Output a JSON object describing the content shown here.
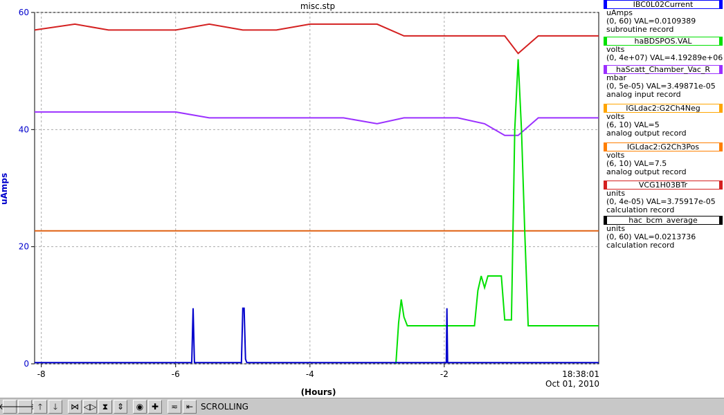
{
  "chart_data": {
    "type": "line",
    "title": "misc.stp",
    "xlabel": "(Hours)",
    "ylabel": "uAmps",
    "xlim": [
      -8.1,
      0.3
    ],
    "ylim": [
      0,
      60
    ],
    "x_ticks": [
      -8,
      -6,
      -4,
      -2
    ],
    "x_tick_labels": [
      "-8",
      "-6",
      "-4",
      "-2"
    ],
    "y_ticks": [
      0,
      20,
      40,
      60
    ],
    "y_tick_labels": [
      "0",
      "20",
      "40",
      "60"
    ],
    "x_end_label": "18:38:01",
    "x_date_label": "Oct 01, 2010",
    "grid": true,
    "series": [
      {
        "color": "#d42020",
        "x": [
          -8.1,
          -7.5,
          -7.0,
          -6.5,
          -6.0,
          -5.5,
          -5.0,
          -4.5,
          -4.0,
          -3.5,
          -3.0,
          -2.6,
          -2.2,
          -1.8,
          -1.4,
          -1.1,
          -0.9,
          -0.6,
          -0.3,
          0.0,
          0.3
        ],
        "values": [
          57,
          58,
          57,
          57,
          57,
          58,
          57,
          57,
          58,
          58,
          58,
          56,
          56,
          56,
          56,
          56,
          53,
          56,
          56,
          56,
          56
        ]
      },
      {
        "color": "#9b30ff",
        "x": [
          -8.1,
          -7.5,
          -7.0,
          -6.5,
          -6.0,
          -5.5,
          -5.0,
          -4.5,
          -4.0,
          -3.5,
          -3.0,
          -2.6,
          -2.2,
          -1.8,
          -1.4,
          -1.1,
          -0.9,
          -0.6,
          -0.3,
          0.0,
          0.3
        ],
        "values": [
          43,
          43,
          43,
          43,
          43,
          42,
          42,
          42,
          42,
          42,
          41,
          42,
          42,
          42,
          41,
          39,
          39,
          42,
          42,
          42,
          42
        ]
      },
      {
        "color": "#e06010",
        "x": [
          -8.1,
          0.3
        ],
        "values": [
          22.7,
          22.7
        ]
      },
      {
        "color": "#00e000",
        "x": [
          -2.72,
          -2.68,
          -2.64,
          -2.6,
          -2.55,
          -2.5,
          -2.0,
          -1.55,
          -1.5,
          -1.45,
          -1.4,
          -1.35,
          -1.3,
          -1.25,
          -1.15,
          -1.1,
          -1.0,
          -0.95,
          -0.9,
          -0.85,
          -0.8,
          -0.75,
          -0.7,
          -0.6,
          -0.5,
          0.0,
          0.3
        ],
        "values": [
          0,
          7,
          11,
          8,
          6.5,
          6.5,
          6.5,
          6.5,
          12.5,
          15,
          13,
          15,
          15,
          15,
          15,
          7.5,
          7.5,
          40,
          52,
          40,
          22,
          6.5,
          6.5,
          6.5,
          6.5,
          6.5,
          6.5
        ]
      },
      {
        "color": "#0000cc",
        "x": [
          -8.1,
          -5.76,
          -5.74,
          -5.72,
          -5.02,
          -5.0,
          -4.98,
          -4.96,
          -4.94,
          -1.97,
          -1.96,
          -1.95,
          0.3
        ],
        "values": [
          0.2,
          0.2,
          9.5,
          0.2,
          0.2,
          9.5,
          9.5,
          0.8,
          0.2,
          0.2,
          9.5,
          0.2,
          0.2
        ]
      }
    ]
  },
  "legend": [
    {
      "name": "IBC0L02Current",
      "color": "#0000ff",
      "units": "uAmps",
      "range_val": "(0, 60) VAL=0.0109389",
      "record": "subroutine record"
    },
    {
      "name": "haBDSPOS.VAL",
      "color": "#00e000",
      "units": "volts",
      "range_val": "(0, 4e+07) VAL=4.19289e+06",
      "record": ""
    },
    {
      "name": "haScatt_Chamber_Vac_R",
      "color": "#9b30ff",
      "units": "mbar",
      "range_val": "(0, 5e-05) VAL=3.49871e-05",
      "record": "analog input record"
    },
    {
      "name": "IGLdac2:G2Ch4Neg",
      "color": "#ffa500",
      "units": "volts",
      "range_val": "(6, 10) VAL=5",
      "record": "analog output record"
    },
    {
      "name": "IGLdac2:G2Ch3Pos",
      "color": "#ff7f00",
      "units": "volts",
      "range_val": "(6, 10) VAL=7.5",
      "record": "analog output record"
    },
    {
      "name": "VCG1H03BTr",
      "color": "#d42020",
      "units": "units",
      "range_val": "(0, 4e-05) VAL=3.75917e-05",
      "record": "calculation record"
    },
    {
      "name": "hac_bcm_average",
      "color": "#000000",
      "units": "units",
      "range_val": "(0, 60) VAL=0.0213736",
      "record": "calculation record"
    }
  ],
  "toolbar": {
    "buttons": [
      {
        "name": "scroll-left-button",
        "glyph": "🡐"
      },
      {
        "name": "scroll-right-button",
        "glyph": "🡒"
      },
      {
        "name": "scroll-up-button",
        "glyph": "🡑"
      },
      {
        "name": "scroll-down-button",
        "glyph": "🡓"
      },
      {
        "name": "zoom-in-x-button",
        "glyph": "⋈"
      },
      {
        "name": "zoom-out-x-button",
        "glyph": "◁▷"
      },
      {
        "name": "zoom-in-y-button",
        "glyph": "⧗"
      },
      {
        "name": "zoom-out-y-button",
        "glyph": "⇕"
      },
      {
        "name": "auto-scale-button",
        "glyph": "◉"
      },
      {
        "name": "crosshair-button",
        "glyph": "✚"
      },
      {
        "name": "config-button",
        "glyph": "≂"
      },
      {
        "name": "scroll-mode-button",
        "glyph": "⇤"
      }
    ],
    "mode_label": "SCROLLING"
  }
}
